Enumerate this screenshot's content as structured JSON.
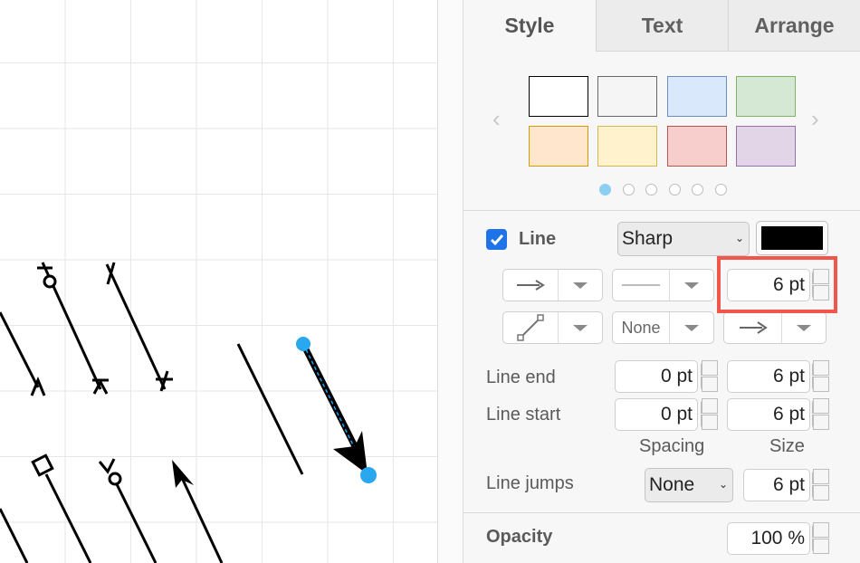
{
  "tabs": [
    {
      "label": "Style",
      "active": true
    },
    {
      "label": "Text",
      "active": false
    },
    {
      "label": "Arrange",
      "active": false
    }
  ],
  "palette": {
    "swatches": [
      {
        "fill": "#ffffff",
        "stroke": "#000000"
      },
      {
        "fill": "#f5f5f5",
        "stroke": "#666666"
      },
      {
        "fill": "#dae8fc",
        "stroke": "#6c8ebf"
      },
      {
        "fill": "#d5e8d4",
        "stroke": "#82b366"
      },
      {
        "fill": "#ffe6cc",
        "stroke": "#d79b00"
      },
      {
        "fill": "#fff2cc",
        "stroke": "#d6b656"
      },
      {
        "fill": "#f8cecc",
        "stroke": "#b85450"
      },
      {
        "fill": "#e1d5e7",
        "stroke": "#9673a6"
      }
    ],
    "prev_icon": "chevron-left-icon",
    "next_icon": "chevron-right-icon",
    "pages": 6,
    "active_page": 1
  },
  "line": {
    "checkbox_checked": true,
    "label": "Line",
    "style_select": "Sharp",
    "color": "#000000",
    "width": "6 pt",
    "end_arrow_icon": "arrow-right-icon",
    "pattern_icon": "solid-line-icon",
    "waypoint_icon": "straight-connector-icon",
    "start_arrow": "None",
    "end_arrow2_icon": "arrow-right-icon"
  },
  "line_end": {
    "label": "Line end",
    "spacing": "0 pt",
    "size": "6 pt"
  },
  "line_start": {
    "label": "Line start",
    "spacing": "0 pt",
    "size": "6 pt"
  },
  "col_labels": {
    "spacing": "Spacing",
    "size": "Size"
  },
  "line_jumps": {
    "label": "Line jumps",
    "value": "None",
    "size": "6 pt"
  },
  "opacity": {
    "label": "Opacity",
    "value": "100 %"
  },
  "colors": {
    "accent": "#1ea1f1",
    "highlight": "#f2554a",
    "checkbox": "#1e73e8"
  }
}
